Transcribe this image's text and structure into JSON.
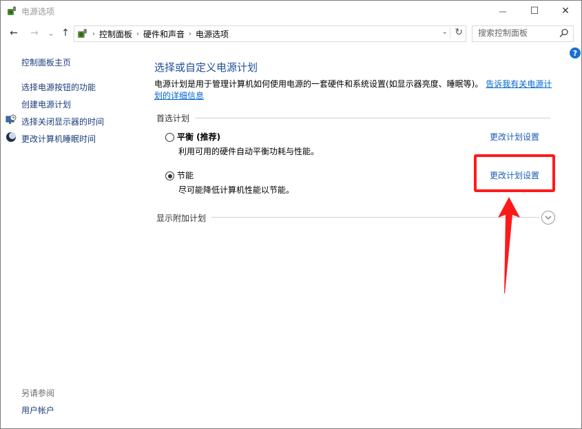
{
  "window": {
    "title": "电源选项",
    "controls": {
      "minimize": "—",
      "maximize": "☐",
      "close": "✕"
    }
  },
  "addressbar": {
    "nav": {
      "back": "←",
      "forward": "→",
      "recent": "⌄",
      "up": "↑"
    },
    "breadcrumbs": [
      "控制面板",
      "硬件和声音",
      "电源选项"
    ],
    "separator": "›",
    "dropdown": "⌄",
    "refresh": "↻"
  },
  "search": {
    "placeholder": "搜索控制面板"
  },
  "help": {
    "label": "?"
  },
  "sidebar": {
    "home": "控制面板主页",
    "links": [
      "选择电源按钮的功能",
      "创建电源计划",
      "选择关闭显示器的时间",
      "更改计算机睡眠时间"
    ],
    "see_also_label": "另请参阅",
    "see_also_links": [
      "用户帐户"
    ]
  },
  "main": {
    "title": "选择或自定义电源计划",
    "description": "电源计划是用于管理计算机如何使用电源的一套硬件和系统设置(如显示器亮度、睡眠等)。",
    "description_link": "告诉我有关电源计划的详细信息",
    "preferred_group": "首选计划",
    "plans": [
      {
        "name": "平衡 (推荐)",
        "description": "利用可用的硬件自动平衡功耗与性能。",
        "link": "更改计划设置",
        "selected": false
      },
      {
        "name": "节能",
        "description": "尽可能降低计算机性能以节能。",
        "link": "更改计划设置",
        "selected": true
      }
    ],
    "extra_group": "显示附加计划"
  },
  "annotation": {
    "highlight_color": "#ff1a1a"
  },
  "colors": {
    "title": "#1e4e9a",
    "link": "#1a5cb5",
    "sidebar_link": "#1a3d7a"
  }
}
